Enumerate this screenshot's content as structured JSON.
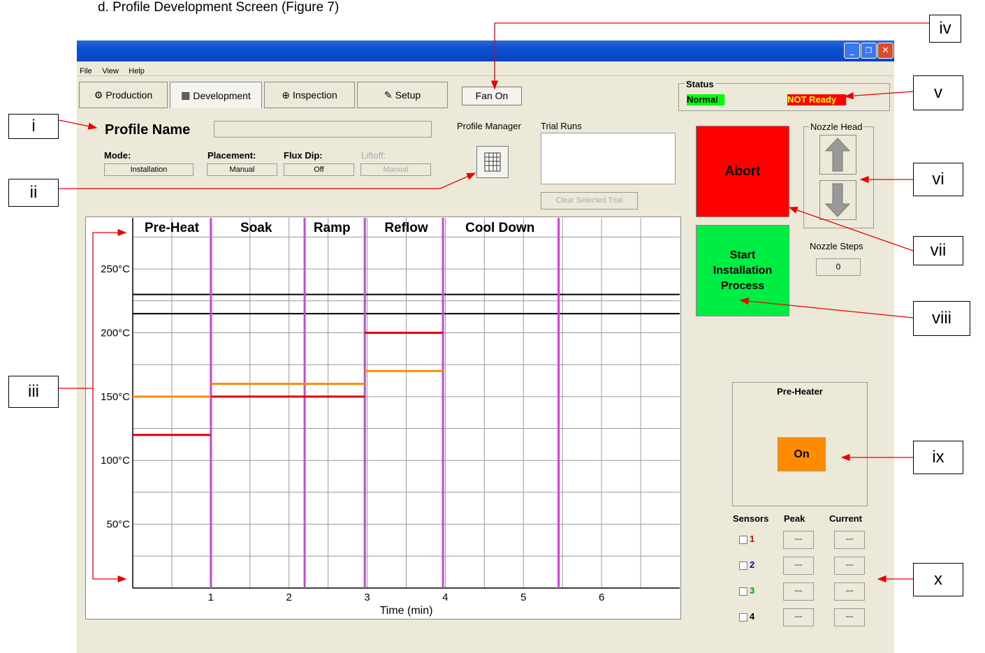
{
  "caption": "d.   Profile Development Screen  (Figure 7)",
  "window": {
    "min_glyph": "_",
    "max_glyph": "❐",
    "close_glyph": "✕"
  },
  "menu": [
    "File",
    "View",
    "Help"
  ],
  "tabs": [
    {
      "label": "Production",
      "icon": "⚙"
    },
    {
      "label": "Development",
      "icon": "▦"
    },
    {
      "label": "Inspection",
      "icon": "⊕"
    },
    {
      "label": "Setup",
      "icon": "✎"
    }
  ],
  "fan_button": "Fan On",
  "status": {
    "title": "Status",
    "normal": "Normal",
    "ready": "NOT Ready",
    "normal_color": "#00ff00",
    "ready_color": "#ff0000"
  },
  "profile": {
    "name_label": "Profile Name",
    "name_value": "",
    "mode_label": "Mode:",
    "mode_value": "Installation",
    "placement_label": "Placement:",
    "placement_value": "Manual",
    "flux_label": "Flux Dip:",
    "flux_value": "Off",
    "liftoff_label": "Liftoff:",
    "liftoff_value": "Manual"
  },
  "profile_manager_label": "Profile Manager",
  "trial_runs_label": "Trial Runs",
  "clear_trial_button": "Clear Selected Trial",
  "abort_button": "Abort",
  "start_button": [
    "Start",
    "Installation",
    "Process"
  ],
  "nozzle": {
    "head_label": "Nozzle Head",
    "steps_label": "Nozzle Steps",
    "steps_value": "0"
  },
  "preheater": {
    "title": "Pre-Heater",
    "button": "On"
  },
  "sensors": {
    "headers": [
      "Sensors",
      "Peak",
      "Current"
    ],
    "rows": [
      {
        "id": "1",
        "color": "#cc0000",
        "peak": "---",
        "current": "---"
      },
      {
        "id": "2",
        "color": "#0000cc",
        "peak": "---",
        "current": "---"
      },
      {
        "id": "3",
        "color": "#009900",
        "peak": "---",
        "current": "---"
      },
      {
        "id": "4",
        "color": "#000000",
        "peak": "---",
        "current": "---"
      }
    ]
  },
  "callouts": [
    "i",
    "ii",
    "iii",
    "iv",
    "v",
    "vi",
    "vii",
    "viii",
    "ix",
    "x"
  ],
  "chart_data": {
    "type": "line",
    "xlabel": "Time (min)",
    "x_ticks": [
      "1",
      "2",
      "3",
      "4",
      "5",
      "6"
    ],
    "y_ticks": [
      "50°C",
      "100°C",
      "150°C",
      "200°C",
      "250°C"
    ],
    "xlim": [
      0,
      7
    ],
    "ylim": [
      0,
      290
    ],
    "phases": [
      "Pre-Heat",
      "Soak",
      "Ramp",
      "Reflow",
      "Cool Down"
    ],
    "phase_boundaries": [
      1,
      2.2,
      2.97,
      3.97,
      5.45
    ],
    "horizontal_lines": [
      230,
      215
    ],
    "max_segments": [
      {
        "x": [
          0,
          1
        ],
        "y": 150
      },
      {
        "x": [
          1,
          2.97
        ],
        "y": 160
      },
      {
        "x": [
          2.97,
          3.97
        ],
        "y": 170
      }
    ],
    "min_segments": [
      {
        "x": [
          0,
          1
        ],
        "y": 120
      },
      {
        "x": [
          1,
          2.97
        ],
        "y": 150
      },
      {
        "x": [
          2.97,
          3.97
        ],
        "y": 200
      }
    ],
    "max_color": "#ff8c00",
    "min_color": "#e00000",
    "phase_color": "#cc44dd"
  }
}
